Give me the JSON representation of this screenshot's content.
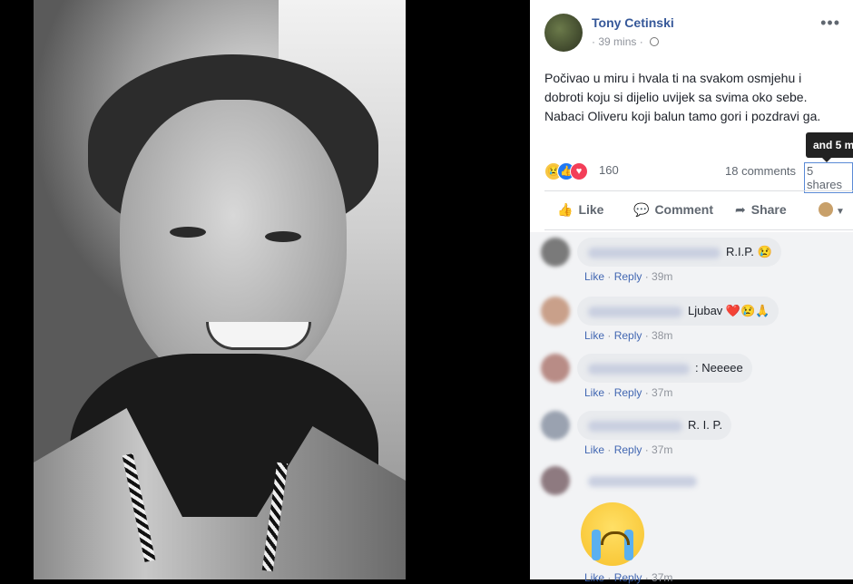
{
  "post": {
    "author": "Tony Cetinski",
    "time": "39 mins",
    "privacy_icon": "globe-icon",
    "text_lines": [
      "Počivao u miru i hvala ti na svakom osmjehu i",
      "dobroti koju si dijelio uvijek sa svima oko sebe.",
      "Nabaci Oliveru koji balun tamo gori i pozdravi ga."
    ]
  },
  "tooltip": "and 5 m",
  "stats": {
    "reactions_count": "160",
    "comments": "18 comments",
    "shares": "5 shares",
    "reaction_icons": [
      "sad-icon",
      "like-icon",
      "love-icon"
    ]
  },
  "actions": {
    "like": "Like",
    "comment": "Comment",
    "share": "Share"
  },
  "comments": [
    {
      "text": "R.I.P. 😢",
      "like": "Like",
      "reply": "Reply",
      "time": "39m"
    },
    {
      "text": "Ljubav ❤️😢🙏",
      "like": "Like",
      "reply": "Reply",
      "time": "38m"
    },
    {
      "text": ": Neeeee",
      "like": "Like",
      "reply": "Reply",
      "time": "37m"
    },
    {
      "text": "R. I. P.",
      "like": "Like",
      "reply": "Reply",
      "time": "37m"
    },
    {
      "text": "",
      "like": "Like",
      "reply": "Reply",
      "time": "37m"
    }
  ],
  "colors": {
    "link": "#365899",
    "accent": "#4267b2",
    "muted": "#90949c"
  }
}
